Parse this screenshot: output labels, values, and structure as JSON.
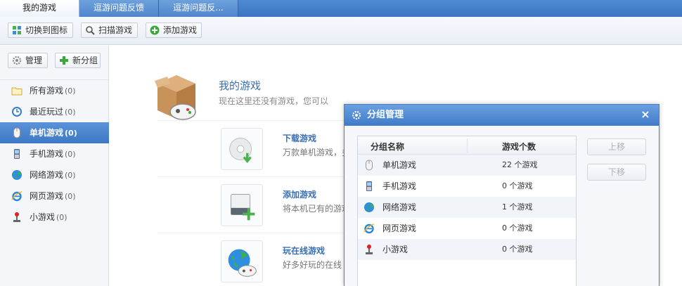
{
  "tabs": [
    {
      "label": "我的游戏",
      "active": true
    },
    {
      "label": "逗游问题反馈",
      "active": false
    },
    {
      "label": "逗游问题反...",
      "active": false
    }
  ],
  "toolbar": {
    "switch_label": "切换到图标",
    "scan_label": "扫描游戏",
    "add_label": "添加游戏"
  },
  "sidebar": {
    "manage_label": "管理",
    "new_group_label": "新分组",
    "categories": [
      {
        "label": "所有游戏",
        "count": "(0)",
        "icon": "folder-icon"
      },
      {
        "label": "最近玩过",
        "count": "(0)",
        "icon": "clock-icon"
      },
      {
        "label": "单机游戏",
        "count": "(0)",
        "icon": "mouse-icon",
        "selected": true
      },
      {
        "label": "手机游戏",
        "count": "(0)",
        "icon": "phone-icon"
      },
      {
        "label": "网络游戏",
        "count": "(0)",
        "icon": "globe-icon"
      },
      {
        "label": "网页游戏",
        "count": "(0)",
        "icon": "ie-icon"
      },
      {
        "label": "小游戏",
        "count": "(0)",
        "icon": "joystick-icon"
      }
    ]
  },
  "main": {
    "title": "我的游戏",
    "subtitle": "现在这里还没有游戏，您可以",
    "entries": [
      {
        "title": "下载游戏",
        "desc": "万款单机游戏，多",
        "icon": "disc-download-icon"
      },
      {
        "title": "添加游戏",
        "desc": "将本机已有的游戏",
        "icon": "drive-add-icon"
      },
      {
        "title": "玩在线游戏",
        "desc": "好多好玩的在线",
        "icon": "globe-gamepad-icon"
      }
    ]
  },
  "dialog": {
    "title": "分组管理",
    "close": "×",
    "col_name": "分组名称",
    "col_count": "游戏个数",
    "up_label": "上移",
    "down_label": "下移",
    "rows": [
      {
        "name": "单机游戏",
        "count": "22 个游戏",
        "icon": "mouse-icon"
      },
      {
        "name": "手机游戏",
        "count": "0 个游戏",
        "icon": "phone-icon"
      },
      {
        "name": "网络游戏",
        "count": "1 个游戏",
        "icon": "globe-icon"
      },
      {
        "name": "网页游戏",
        "count": "0 个游戏",
        "icon": "ie-icon"
      },
      {
        "name": "小游戏",
        "count": "0 个游戏",
        "icon": "joystick-icon"
      }
    ]
  },
  "colors": {
    "accent": "#3d78c4",
    "link": "#3a6fb0"
  }
}
